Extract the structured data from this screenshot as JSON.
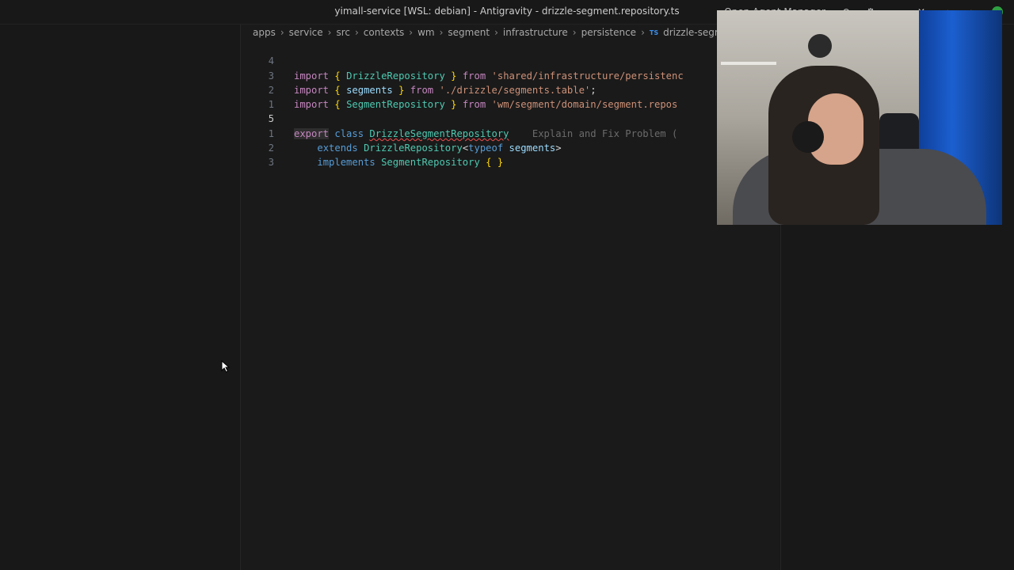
{
  "window": {
    "title": "yimall-service [WSL: debian] - Antigravity - drizzle-segment.repository.ts",
    "right_label": "Open Agent Manager"
  },
  "breadcrumb": {
    "items": [
      "apps",
      "service",
      "src",
      "contexts",
      "wm",
      "segment",
      "infrastructure",
      "persistence"
    ],
    "file_badge": "TS",
    "file_name": "drizzle-segment.reposi"
  },
  "code": {
    "lines": [
      {
        "num": "4",
        "imp": "import",
        "open": "{",
        "name": "DrizzleRepository",
        "close": "}",
        "from": "from",
        "str": "'shared/infrastructure/persistenc"
      },
      {
        "num": "3",
        "imp": "import",
        "open": "{",
        "name": "segments",
        "close": "}",
        "from": "from",
        "str": "'./drizzle/segments.table'",
        "end": ";"
      },
      {
        "num": "2",
        "imp": "import",
        "open": "{",
        "name": "SegmentRepository",
        "close": "}",
        "from": "from",
        "str": "'wm/segment/domain/segment.repos"
      },
      {
        "num": "1"
      },
      {
        "num": "5",
        "export": "export",
        "class_kw": "class",
        "class_name": "DrizzleSegmentRepository",
        "hint": "Explain and Fix Problem ("
      },
      {
        "num": "1",
        "extends": "extends",
        "base": "DrizzleRepository",
        "lt": "<",
        "typeof": "typeof",
        "arg": "segments",
        "gt": ">"
      },
      {
        "num": "2",
        "implements": "implements",
        "iface": "SegmentRepository",
        "body": "{ }"
      },
      {
        "num": "3"
      }
    ]
  },
  "colors": {
    "background": "#181818",
    "keyword_control": "#c586c0",
    "keyword": "#569cd6",
    "type": "#4ec9b0",
    "string": "#ce9178",
    "variable": "#9cdcfe",
    "bracket": "#ffd700"
  }
}
